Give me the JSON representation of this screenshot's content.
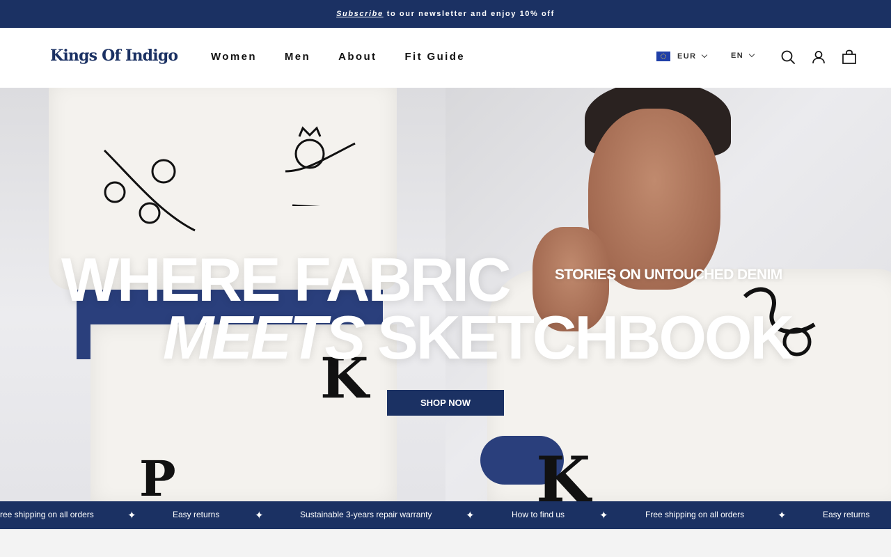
{
  "announcement": {
    "link_text": "Subscribe",
    "text": "to our newsletter and enjoy 10% off"
  },
  "header": {
    "logo": "Kings Of Indigo",
    "nav": [
      "Women",
      "Men",
      "About",
      "Fit Guide"
    ],
    "currency": "EUR",
    "language": "EN"
  },
  "hero": {
    "headline_line1": "WHERE FABRIC",
    "headline_line2_italic": "MEETS",
    "headline_line2_rest": "SKETCHBOOK",
    "subheadline": "STORIES ON UNTOUCHED DENIM",
    "cta_label": "SHOP NOW"
  },
  "marquee": {
    "items": [
      "ree shipping on all orders",
      "Easy returns",
      "Sustainable 3-years repair warranty",
      "How to find us",
      "Free shipping on all orders",
      "Easy returns"
    ]
  },
  "colors": {
    "brand_navy": "#1b3163",
    "white": "#ffffff"
  }
}
